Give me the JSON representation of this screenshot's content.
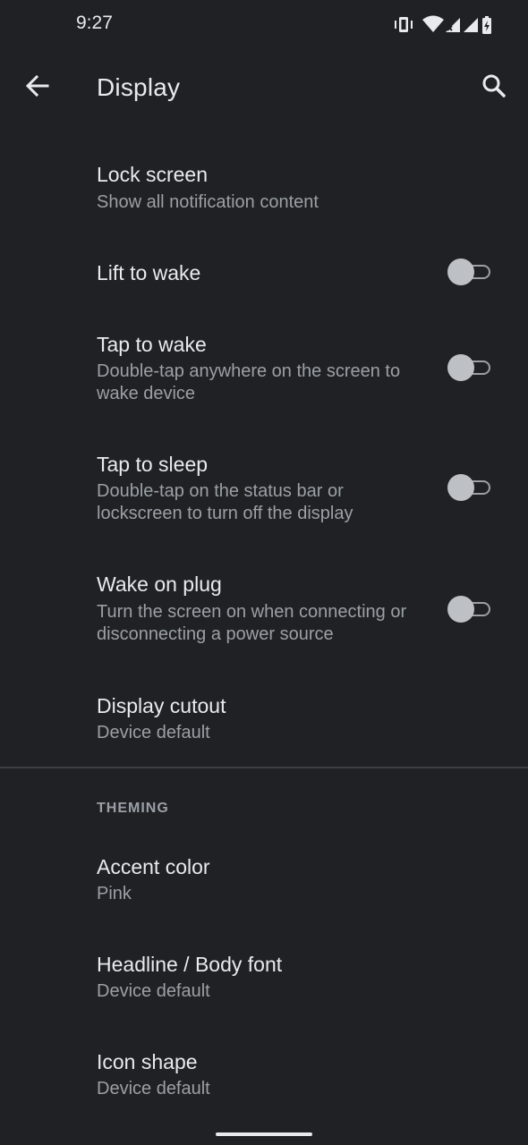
{
  "status_bar": {
    "time": "9:27",
    "icons": [
      "vibrate-icon",
      "wifi-icon",
      "signal-icon",
      "battery-charging-icon"
    ]
  },
  "app_bar": {
    "title": "Display",
    "back_icon": "arrow-back-icon",
    "search_icon": "search-icon"
  },
  "preferences": [
    {
      "title": "Lock screen",
      "summary": "Show all notification content"
    },
    {
      "title": "Lift to wake",
      "switch_on": false
    },
    {
      "title": "Tap to wake",
      "summary": "Double-tap anywhere on the screen to wake device",
      "switch_on": false
    },
    {
      "title": "Tap to sleep",
      "summary": "Double-tap on the status bar or lockscreen to turn off the display",
      "switch_on": false
    },
    {
      "title": "Wake on plug",
      "summary": "Turn the screen on when connecting or disconnecting a power source",
      "switch_on": false
    },
    {
      "title": "Display cutout",
      "summary": "Device default"
    }
  ],
  "theming": {
    "header": "THEMING",
    "items": [
      {
        "title": "Accent color",
        "summary": "Pink"
      },
      {
        "title": "Headline / Body font",
        "summary": "Device default"
      },
      {
        "title": "Icon shape",
        "summary": "Device default"
      }
    ]
  },
  "colors": {
    "background": "#202124",
    "text_primary": "#e8eaed",
    "text_secondary": "#9aa0a6",
    "switch_thumb_off": "#bdc1c6"
  }
}
